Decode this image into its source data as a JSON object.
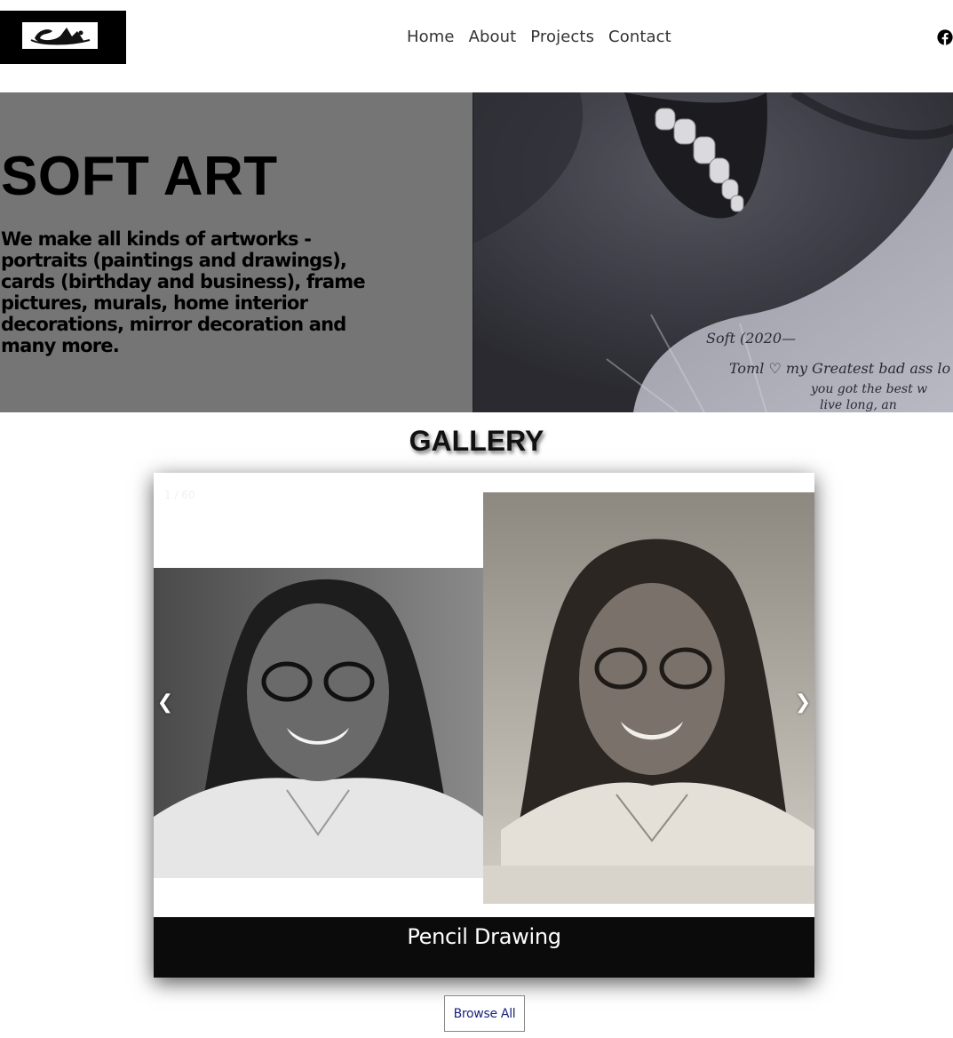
{
  "header": {
    "logo_text": "SA",
    "nav": [
      {
        "label": "Home"
      },
      {
        "label": "About"
      },
      {
        "label": "Projects"
      },
      {
        "label": "Contact"
      }
    ],
    "social_icon": "facebook-icon"
  },
  "hero": {
    "title": "SOFT ART",
    "description": "We make all kinds of artworks - portraits (paintings and drawings), cards (birthday and business), frame pictures, murals, home interior decorations, mirror decoration and many more.",
    "background_color": "#757575",
    "image_handwriting": [
      "Soft (2020—",
      "Toml ♡  my Greatest bad ass lo",
      "you got the best w",
      "live long, an"
    ]
  },
  "gallery": {
    "title": "GALLERY",
    "counter": "1 / 60",
    "prev_symbol": "❮",
    "next_symbol": "❯",
    "caption": "Pencil Drawing",
    "browse_label": "Browse All"
  },
  "colors": {
    "caption_bg": "#0b0b0b",
    "browse_text": "#1a237e"
  }
}
